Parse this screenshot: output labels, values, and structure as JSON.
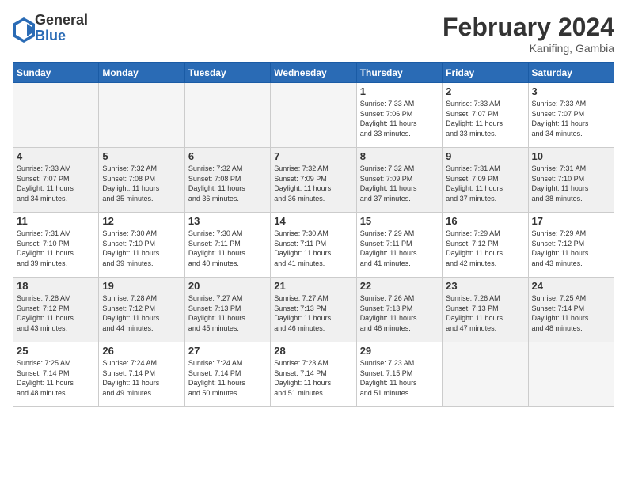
{
  "header": {
    "logo_general": "General",
    "logo_blue": "Blue",
    "month_title": "February 2024",
    "location": "Kanifing, Gambia"
  },
  "days_of_week": [
    "Sunday",
    "Monday",
    "Tuesday",
    "Wednesday",
    "Thursday",
    "Friday",
    "Saturday"
  ],
  "weeks": [
    [
      {
        "day": "",
        "info": ""
      },
      {
        "day": "",
        "info": ""
      },
      {
        "day": "",
        "info": ""
      },
      {
        "day": "",
        "info": ""
      },
      {
        "day": "1",
        "info": "Sunrise: 7:33 AM\nSunset: 7:06 PM\nDaylight: 11 hours\nand 33 minutes."
      },
      {
        "day": "2",
        "info": "Sunrise: 7:33 AM\nSunset: 7:07 PM\nDaylight: 11 hours\nand 33 minutes."
      },
      {
        "day": "3",
        "info": "Sunrise: 7:33 AM\nSunset: 7:07 PM\nDaylight: 11 hours\nand 34 minutes."
      }
    ],
    [
      {
        "day": "4",
        "info": "Sunrise: 7:33 AM\nSunset: 7:07 PM\nDaylight: 11 hours\nand 34 minutes."
      },
      {
        "day": "5",
        "info": "Sunrise: 7:32 AM\nSunset: 7:08 PM\nDaylight: 11 hours\nand 35 minutes."
      },
      {
        "day": "6",
        "info": "Sunrise: 7:32 AM\nSunset: 7:08 PM\nDaylight: 11 hours\nand 36 minutes."
      },
      {
        "day": "7",
        "info": "Sunrise: 7:32 AM\nSunset: 7:09 PM\nDaylight: 11 hours\nand 36 minutes."
      },
      {
        "day": "8",
        "info": "Sunrise: 7:32 AM\nSunset: 7:09 PM\nDaylight: 11 hours\nand 37 minutes."
      },
      {
        "day": "9",
        "info": "Sunrise: 7:31 AM\nSunset: 7:09 PM\nDaylight: 11 hours\nand 37 minutes."
      },
      {
        "day": "10",
        "info": "Sunrise: 7:31 AM\nSunset: 7:10 PM\nDaylight: 11 hours\nand 38 minutes."
      }
    ],
    [
      {
        "day": "11",
        "info": "Sunrise: 7:31 AM\nSunset: 7:10 PM\nDaylight: 11 hours\nand 39 minutes."
      },
      {
        "day": "12",
        "info": "Sunrise: 7:30 AM\nSunset: 7:10 PM\nDaylight: 11 hours\nand 39 minutes."
      },
      {
        "day": "13",
        "info": "Sunrise: 7:30 AM\nSunset: 7:11 PM\nDaylight: 11 hours\nand 40 minutes."
      },
      {
        "day": "14",
        "info": "Sunrise: 7:30 AM\nSunset: 7:11 PM\nDaylight: 11 hours\nand 41 minutes."
      },
      {
        "day": "15",
        "info": "Sunrise: 7:29 AM\nSunset: 7:11 PM\nDaylight: 11 hours\nand 41 minutes."
      },
      {
        "day": "16",
        "info": "Sunrise: 7:29 AM\nSunset: 7:12 PM\nDaylight: 11 hours\nand 42 minutes."
      },
      {
        "day": "17",
        "info": "Sunrise: 7:29 AM\nSunset: 7:12 PM\nDaylight: 11 hours\nand 43 minutes."
      }
    ],
    [
      {
        "day": "18",
        "info": "Sunrise: 7:28 AM\nSunset: 7:12 PM\nDaylight: 11 hours\nand 43 minutes."
      },
      {
        "day": "19",
        "info": "Sunrise: 7:28 AM\nSunset: 7:12 PM\nDaylight: 11 hours\nand 44 minutes."
      },
      {
        "day": "20",
        "info": "Sunrise: 7:27 AM\nSunset: 7:13 PM\nDaylight: 11 hours\nand 45 minutes."
      },
      {
        "day": "21",
        "info": "Sunrise: 7:27 AM\nSunset: 7:13 PM\nDaylight: 11 hours\nand 46 minutes."
      },
      {
        "day": "22",
        "info": "Sunrise: 7:26 AM\nSunset: 7:13 PM\nDaylight: 11 hours\nand 46 minutes."
      },
      {
        "day": "23",
        "info": "Sunrise: 7:26 AM\nSunset: 7:13 PM\nDaylight: 11 hours\nand 47 minutes."
      },
      {
        "day": "24",
        "info": "Sunrise: 7:25 AM\nSunset: 7:14 PM\nDaylight: 11 hours\nand 48 minutes."
      }
    ],
    [
      {
        "day": "25",
        "info": "Sunrise: 7:25 AM\nSunset: 7:14 PM\nDaylight: 11 hours\nand 48 minutes."
      },
      {
        "day": "26",
        "info": "Sunrise: 7:24 AM\nSunset: 7:14 PM\nDaylight: 11 hours\nand 49 minutes."
      },
      {
        "day": "27",
        "info": "Sunrise: 7:24 AM\nSunset: 7:14 PM\nDaylight: 11 hours\nand 50 minutes."
      },
      {
        "day": "28",
        "info": "Sunrise: 7:23 AM\nSunset: 7:14 PM\nDaylight: 11 hours\nand 51 minutes."
      },
      {
        "day": "29",
        "info": "Sunrise: 7:23 AM\nSunset: 7:15 PM\nDaylight: 11 hours\nand 51 minutes."
      },
      {
        "day": "",
        "info": ""
      },
      {
        "day": "",
        "info": ""
      }
    ]
  ]
}
